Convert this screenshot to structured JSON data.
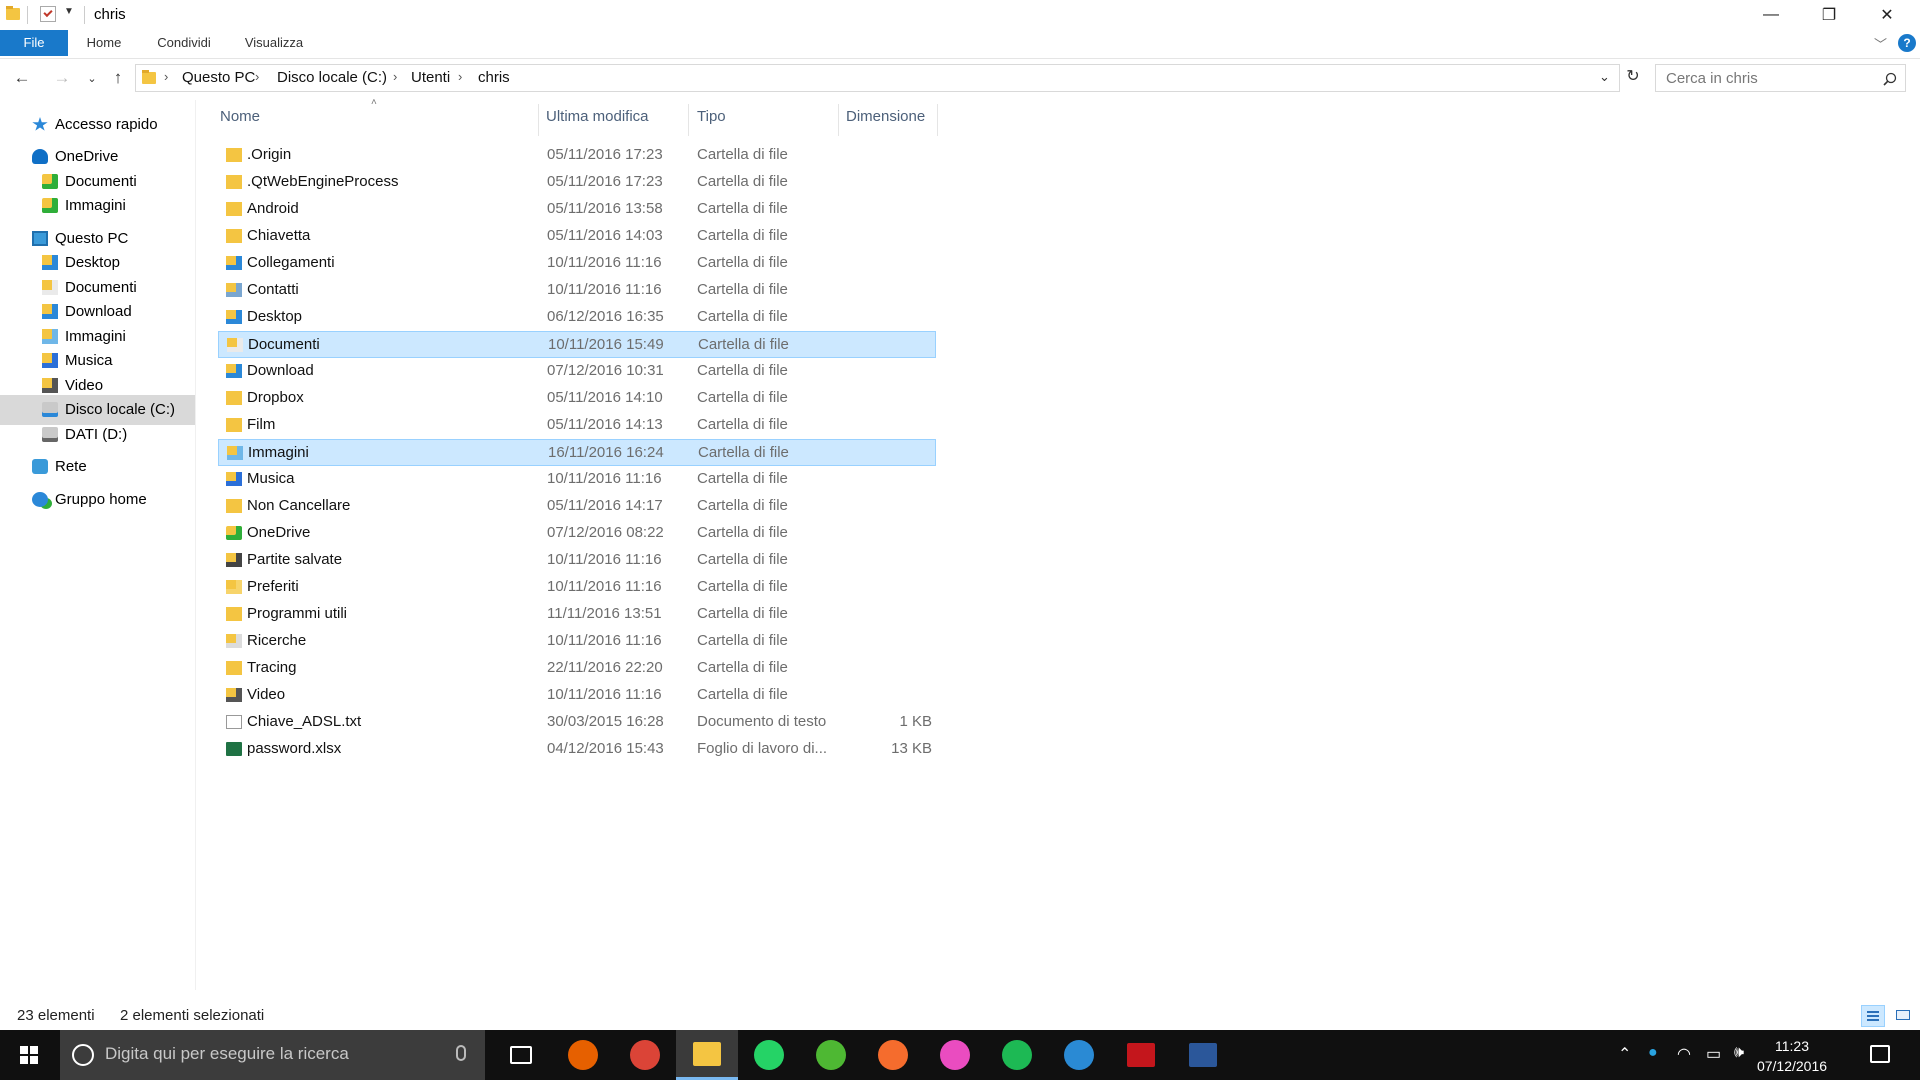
{
  "window": {
    "title": "chris",
    "controls": {
      "minimize": "—",
      "maximize": "❐",
      "close": "✕"
    }
  },
  "ribbon": {
    "tabs": [
      "File",
      "Home",
      "Condividi",
      "Visualizza"
    ],
    "help": "?"
  },
  "address": {
    "crumbs": [
      "Questo PC",
      "Disco locale (C:)",
      "Utenti",
      "chris"
    ],
    "separator": "›",
    "search_placeholder": "Cerca in chris"
  },
  "nav": {
    "items": [
      {
        "label": "Accesso rapido",
        "icon": "star-icon"
      },
      {
        "label": "OneDrive",
        "icon": "onedrive-icon"
      },
      {
        "label": "Documenti",
        "icon": "onedrive-folder-icon"
      },
      {
        "label": "Immagini",
        "icon": "onedrive-folder-icon"
      },
      {
        "label": "Questo PC",
        "icon": "pc-icon"
      },
      {
        "label": "Desktop",
        "icon": "desktop-folder-icon"
      },
      {
        "label": "Documenti",
        "icon": "documents-folder-icon"
      },
      {
        "label": "Download",
        "icon": "download-folder-icon"
      },
      {
        "label": "Immagini",
        "icon": "pictures-folder-icon"
      },
      {
        "label": "Musica",
        "icon": "music-folder-icon"
      },
      {
        "label": "Video",
        "icon": "video-folder-icon"
      },
      {
        "label": "Disco locale (C:)",
        "icon": "drive-c-icon",
        "selected": true
      },
      {
        "label": "DATI (D:)",
        "icon": "drive-icon"
      },
      {
        "label": "Rete",
        "icon": "network-icon"
      },
      {
        "label": "Gruppo home",
        "icon": "homegroup-icon"
      }
    ]
  },
  "columns": {
    "name": "Nome",
    "modified": "Ultima modifica",
    "type": "Tipo",
    "size": "Dimensione"
  },
  "files": [
    {
      "name": ".Origin",
      "modified": "05/11/2016 17:23",
      "type": "Cartella di file",
      "size": "",
      "icon": "folder-icon"
    },
    {
      "name": ".QtWebEngineProcess",
      "modified": "05/11/2016 17:23",
      "type": "Cartella di file",
      "size": "",
      "icon": "folder-icon"
    },
    {
      "name": "Android",
      "modified": "05/11/2016 13:58",
      "type": "Cartella di file",
      "size": "",
      "icon": "folder-icon"
    },
    {
      "name": "Chiavetta",
      "modified": "05/11/2016 14:03",
      "type": "Cartella di file",
      "size": "",
      "icon": "folder-icon"
    },
    {
      "name": "Collegamenti",
      "modified": "10/11/2016 11:16",
      "type": "Cartella di file",
      "size": "",
      "icon": "links-folder-icon"
    },
    {
      "name": "Contatti",
      "modified": "10/11/2016 11:16",
      "type": "Cartella di file",
      "size": "",
      "icon": "contacts-folder-icon"
    },
    {
      "name": "Desktop",
      "modified": "06/12/2016 16:35",
      "type": "Cartella di file",
      "size": "",
      "icon": "desktop-folder-icon"
    },
    {
      "name": "Documenti",
      "modified": "10/11/2016 15:49",
      "type": "Cartella di file",
      "size": "",
      "icon": "documents-folder-icon",
      "selected": true
    },
    {
      "name": "Download",
      "modified": "07/12/2016 10:31",
      "type": "Cartella di file",
      "size": "",
      "icon": "download-folder-icon"
    },
    {
      "name": "Dropbox",
      "modified": "05/11/2016 14:10",
      "type": "Cartella di file",
      "size": "",
      "icon": "folder-icon"
    },
    {
      "name": "Film",
      "modified": "05/11/2016 14:13",
      "type": "Cartella di file",
      "size": "",
      "icon": "folder-icon"
    },
    {
      "name": "Immagini",
      "modified": "16/11/2016 16:24",
      "type": "Cartella di file",
      "size": "",
      "icon": "pictures-folder-icon",
      "selected": true
    },
    {
      "name": "Musica",
      "modified": "10/11/2016 11:16",
      "type": "Cartella di file",
      "size": "",
      "icon": "music-folder-icon"
    },
    {
      "name": "Non Cancellare",
      "modified": "05/11/2016 14:17",
      "type": "Cartella di file",
      "size": "",
      "icon": "folder-icon"
    },
    {
      "name": "OneDrive",
      "modified": "07/12/2016 08:22",
      "type": "Cartella di file",
      "size": "",
      "icon": "onedrive-folder-icon"
    },
    {
      "name": "Partite salvate",
      "modified": "10/11/2016 11:16",
      "type": "Cartella di file",
      "size": "",
      "icon": "saved-games-folder-icon"
    },
    {
      "name": "Preferiti",
      "modified": "10/11/2016 11:16",
      "type": "Cartella di file",
      "size": "",
      "icon": "favorites-folder-icon"
    },
    {
      "name": "Programmi utili",
      "modified": "11/11/2016 13:51",
      "type": "Cartella di file",
      "size": "",
      "icon": "folder-icon"
    },
    {
      "name": "Ricerche",
      "modified": "10/11/2016 11:16",
      "type": "Cartella di file",
      "size": "",
      "icon": "searches-folder-icon"
    },
    {
      "name": "Tracing",
      "modified": "22/11/2016 22:20",
      "type": "Cartella di file",
      "size": "",
      "icon": "folder-icon"
    },
    {
      "name": "Video",
      "modified": "10/11/2016 11:16",
      "type": "Cartella di file",
      "size": "",
      "icon": "video-folder-icon"
    },
    {
      "name": "Chiave_ADSL.txt",
      "modified": "30/03/2015 16:28",
      "type": "Documento di testo",
      "size": "1 KB",
      "icon": "text-file-icon"
    },
    {
      "name": "password.xlsx",
      "modified": "04/12/2016 15:43",
      "type": "Foglio di lavoro di...",
      "size": "13 KB",
      "icon": "excel-file-icon"
    }
  ],
  "status": {
    "count": "23 elementi",
    "selected": "2 elementi selezionati"
  },
  "taskbar": {
    "search_placeholder": "Digita qui per eseguire la ricerca",
    "apps": [
      "task-view-icon",
      "firefox-icon",
      "chrome-icon",
      "file-explorer-icon",
      "whatsapp-icon",
      "utorrent-icon",
      "origin-icon",
      "itunes-icon",
      "spotify-icon",
      "ccleaner-icon",
      "acrobat-icon",
      "word-icon"
    ],
    "time": "11:23",
    "date": "07/12/2016"
  },
  "colors": {
    "accent": "#1979ca",
    "selection": "#cce8ff",
    "selection_border": "#99d1ff",
    "folder": "#f4c542",
    "taskbar": "#101010"
  }
}
